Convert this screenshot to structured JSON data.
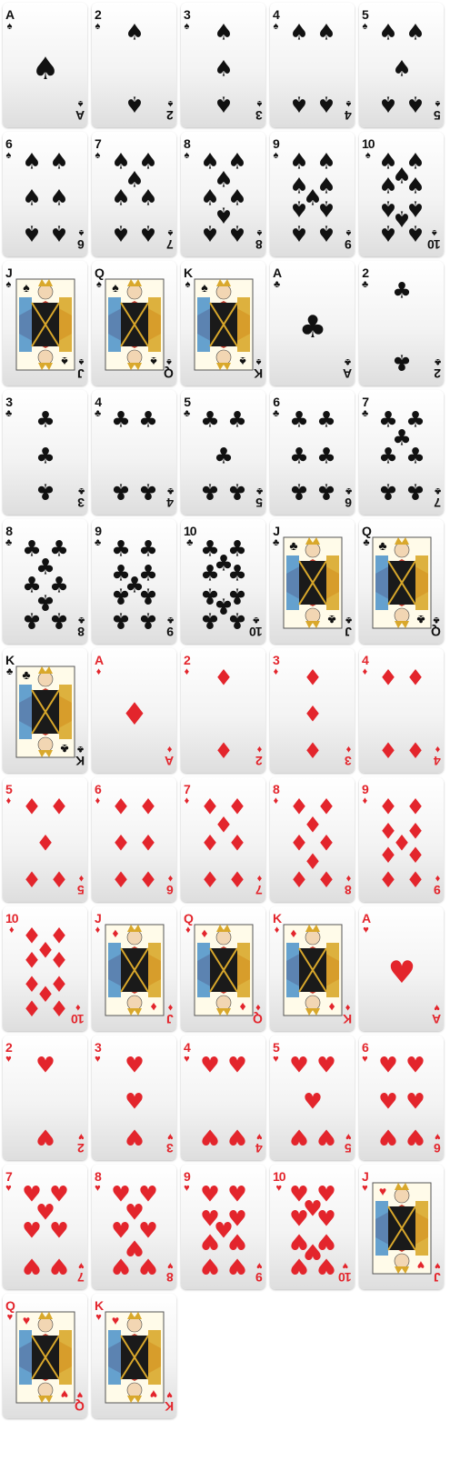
{
  "deck": {
    "columns": 5,
    "colors": {
      "black": "#111111",
      "red": "#e3252c",
      "face_gold": "#d9a82b",
      "face_blue": "#4a90c9",
      "face_red": "#c0392b"
    },
    "suit_icons": {
      "spades": "♠",
      "clubs": "♣",
      "diamonds": "♦",
      "hearts": "♥"
    },
    "cards": [
      {
        "rank": "A",
        "suit": "spades"
      },
      {
        "rank": "2",
        "suit": "spades"
      },
      {
        "rank": "3",
        "suit": "spades"
      },
      {
        "rank": "4",
        "suit": "spades"
      },
      {
        "rank": "5",
        "suit": "spades"
      },
      {
        "rank": "6",
        "suit": "spades"
      },
      {
        "rank": "7",
        "suit": "spades"
      },
      {
        "rank": "8",
        "suit": "spades"
      },
      {
        "rank": "9",
        "suit": "spades"
      },
      {
        "rank": "10",
        "suit": "spades"
      },
      {
        "rank": "J",
        "suit": "spades"
      },
      {
        "rank": "Q",
        "suit": "spades"
      },
      {
        "rank": "K",
        "suit": "spades"
      },
      {
        "rank": "A",
        "suit": "clubs"
      },
      {
        "rank": "2",
        "suit": "clubs"
      },
      {
        "rank": "3",
        "suit": "clubs"
      },
      {
        "rank": "4",
        "suit": "clubs"
      },
      {
        "rank": "5",
        "suit": "clubs"
      },
      {
        "rank": "6",
        "suit": "clubs"
      },
      {
        "rank": "7",
        "suit": "clubs"
      },
      {
        "rank": "8",
        "suit": "clubs"
      },
      {
        "rank": "9",
        "suit": "clubs"
      },
      {
        "rank": "10",
        "suit": "clubs"
      },
      {
        "rank": "J",
        "suit": "clubs"
      },
      {
        "rank": "Q",
        "suit": "clubs"
      },
      {
        "rank": "K",
        "suit": "clubs"
      },
      {
        "rank": "A",
        "suit": "diamonds"
      },
      {
        "rank": "2",
        "suit": "diamonds"
      },
      {
        "rank": "3",
        "suit": "diamonds"
      },
      {
        "rank": "4",
        "suit": "diamonds"
      },
      {
        "rank": "5",
        "suit": "diamonds"
      },
      {
        "rank": "6",
        "suit": "diamonds"
      },
      {
        "rank": "7",
        "suit": "diamonds"
      },
      {
        "rank": "8",
        "suit": "diamonds"
      },
      {
        "rank": "9",
        "suit": "diamonds"
      },
      {
        "rank": "10",
        "suit": "diamonds"
      },
      {
        "rank": "J",
        "suit": "diamonds"
      },
      {
        "rank": "Q",
        "suit": "diamonds"
      },
      {
        "rank": "K",
        "suit": "diamonds"
      },
      {
        "rank": "A",
        "suit": "hearts"
      },
      {
        "rank": "2",
        "suit": "hearts"
      },
      {
        "rank": "3",
        "suit": "hearts"
      },
      {
        "rank": "4",
        "suit": "hearts"
      },
      {
        "rank": "5",
        "suit": "hearts"
      },
      {
        "rank": "6",
        "suit": "hearts"
      },
      {
        "rank": "7",
        "suit": "hearts"
      },
      {
        "rank": "8",
        "suit": "hearts"
      },
      {
        "rank": "9",
        "suit": "hearts"
      },
      {
        "rank": "10",
        "suit": "hearts"
      },
      {
        "rank": "J",
        "suit": "hearts"
      },
      {
        "rank": "Q",
        "suit": "hearts"
      },
      {
        "rank": "K",
        "suit": "hearts"
      }
    ]
  }
}
